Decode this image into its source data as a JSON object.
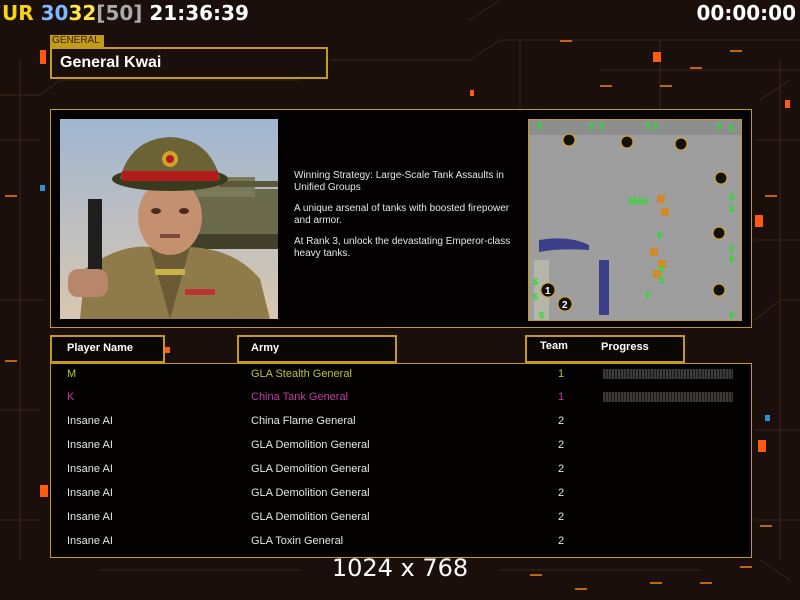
{
  "hud": {
    "ur": "UR",
    "fps_a": "30",
    "fps_b": "32",
    "fps_max": "[50]",
    "clock": "21:36:39",
    "timer": "00:00:00"
  },
  "general": {
    "tag": "GENERAL",
    "name": "General Kwai",
    "description": [
      "Winning Strategy: Large-Scale Tank Assaults in\n Unified Groups",
      "A unique arsenal of tanks with boosted firepower\n and armor.",
      "At Rank 3, unlock the devastating Emperor-class\n heavy tanks."
    ]
  },
  "headers": {
    "player": "Player Name",
    "army": "Army",
    "team": "Team",
    "progress": "Progress"
  },
  "players": [
    {
      "player": "M",
      "army": "GLA Stealth General",
      "team": "1",
      "color": "#b5c43a",
      "show_progress": true
    },
    {
      "player": "K",
      "army": "China Tank General",
      "team": "1",
      "color": "#c23aa8",
      "show_progress": true
    },
    {
      "player": "Insane AI",
      "army": "China Flame General",
      "team": "2",
      "color": "#e6e6e6",
      "show_progress": false
    },
    {
      "player": "Insane AI",
      "army": "GLA Demolition General",
      "team": "2",
      "color": "#e6e6e6",
      "show_progress": false
    },
    {
      "player": "Insane AI",
      "army": "GLA Demolition General",
      "team": "2",
      "color": "#e6e6e6",
      "show_progress": false
    },
    {
      "player": "Insane AI",
      "army": "GLA Demolition General",
      "team": "2",
      "color": "#e6e6e6",
      "show_progress": false
    },
    {
      "player": "Insane AI",
      "army": "GLA Demolition General",
      "team": "2",
      "color": "#e6e6e6",
      "show_progress": false
    },
    {
      "player": "Insane AI",
      "army": "GLA Toxin General",
      "team": "2",
      "color": "#e6e6e6",
      "show_progress": false
    }
  ],
  "minimap": {
    "start_labels": [
      "1",
      "2"
    ],
    "cash_marker": "$",
    "cash_cluster": "$$$$"
  },
  "resolution": "1024 x 768",
  "colors": {
    "accent": "#c29a1c",
    "background": "#1a0f0b",
    "orange_light": "#ff6a1a"
  }
}
